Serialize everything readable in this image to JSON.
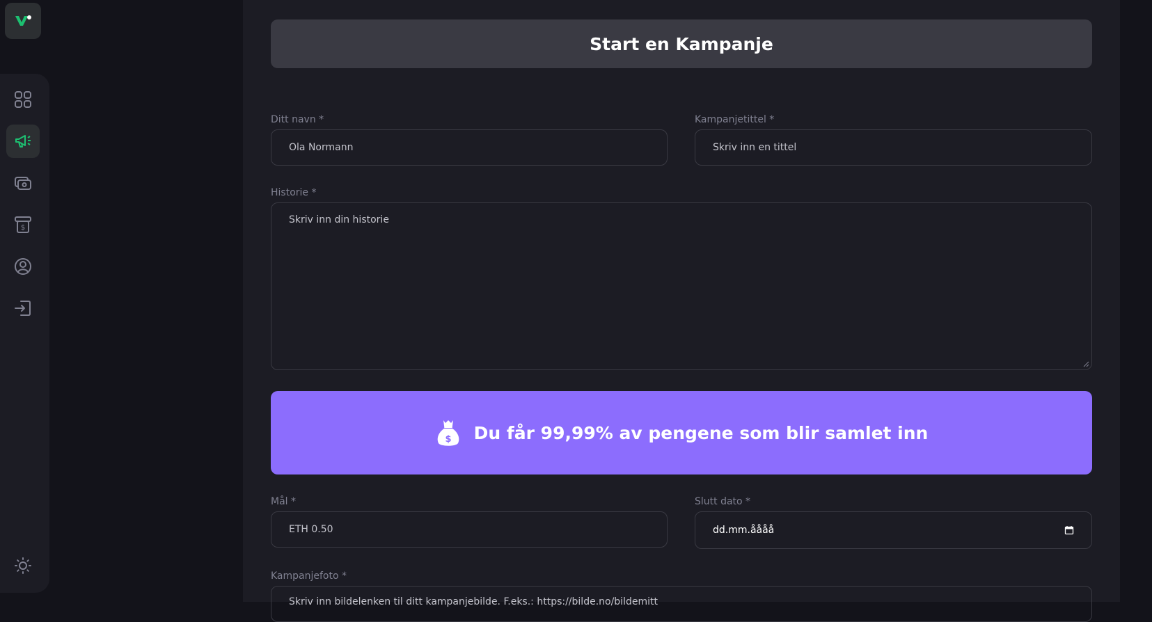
{
  "sidebar": {
    "logo_icon": "brand-logo-icon",
    "items": [
      {
        "icon": "dashboard-grid-icon",
        "active": false
      },
      {
        "icon": "megaphone-icon",
        "active": true
      },
      {
        "icon": "payment-icon",
        "active": false
      },
      {
        "icon": "withdraw-icon",
        "active": false
      },
      {
        "icon": "profile-icon",
        "active": false
      },
      {
        "icon": "logout-icon",
        "active": false
      }
    ],
    "theme_icon": "sun-icon"
  },
  "page": {
    "title": "Start en Kampanje"
  },
  "form": {
    "name_label": "Ditt navn *",
    "name_placeholder": "Ola Normann",
    "title_label": "Kampanjetittel *",
    "title_placeholder": "Skriv inn en tittel",
    "story_label": "Historie *",
    "story_placeholder": "Skriv inn din historie",
    "banner_text": "Du får 99,99% av pengene som blir samlet inn",
    "goal_label": "Mål *",
    "goal_placeholder": "ETH 0.50",
    "end_date_label": "Slutt dato *",
    "end_date_placeholder": "dd.mm.åååå",
    "image_label": "Kampanjefoto *",
    "image_placeholder": "Skriv inn bildelenken til ditt kampanjebilde. F.eks.: https://bilde.no/bildemitt"
  },
  "colors": {
    "accent_green": "#1dc071",
    "banner_purple": "#8c6dfd",
    "background": "#13131a",
    "panel": "#1c1c24"
  }
}
